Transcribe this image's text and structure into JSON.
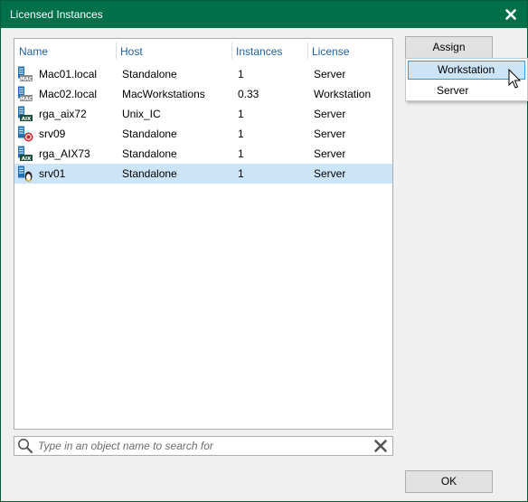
{
  "window": {
    "title": "Licensed Instances"
  },
  "list": {
    "columns": [
      "Name",
      "Host",
      "Instances",
      "License"
    ],
    "rows": [
      {
        "name": "Mac01.local",
        "host": "Standalone",
        "instances": "1",
        "license": "Server",
        "icon": "mac-server-icon",
        "icon_text": "MAC"
      },
      {
        "name": "Mac02.local",
        "host": "MacWorkstations",
        "instances": "0.33",
        "license": "Workstation",
        "icon": "mac-server-icon",
        "icon_text": "MAC"
      },
      {
        "name": "rga_aix72",
        "host": "Unix_IC",
        "instances": "1",
        "license": "Server",
        "icon": "aix-server-icon",
        "icon_text": "AIX"
      },
      {
        "name": "srv09",
        "host": "Standalone",
        "instances": "1",
        "license": "Server",
        "icon": "solaris-server-icon",
        "icon_text": ""
      },
      {
        "name": "rga_AIX73",
        "host": "Standalone",
        "instances": "1",
        "license": "Server",
        "icon": "aix-server-icon",
        "icon_text": "AIX"
      },
      {
        "name": "srv01",
        "host": "Standalone",
        "instances": "1",
        "license": "Server",
        "icon": "linux-server-icon",
        "icon_text": ""
      }
    ],
    "selected_row": 5
  },
  "search": {
    "placeholder": "Type in an object name to search for",
    "value": ""
  },
  "buttons": {
    "assign": "Assign",
    "ok": "OK"
  },
  "assign_menu": {
    "items": [
      "Workstation",
      "Server"
    ],
    "hovered": "Workstation"
  },
  "colors": {
    "titlebar": "#00704a",
    "header_text": "#1c5fa8",
    "selection": "#cce4f7",
    "hover_border": "#3e93d6"
  }
}
